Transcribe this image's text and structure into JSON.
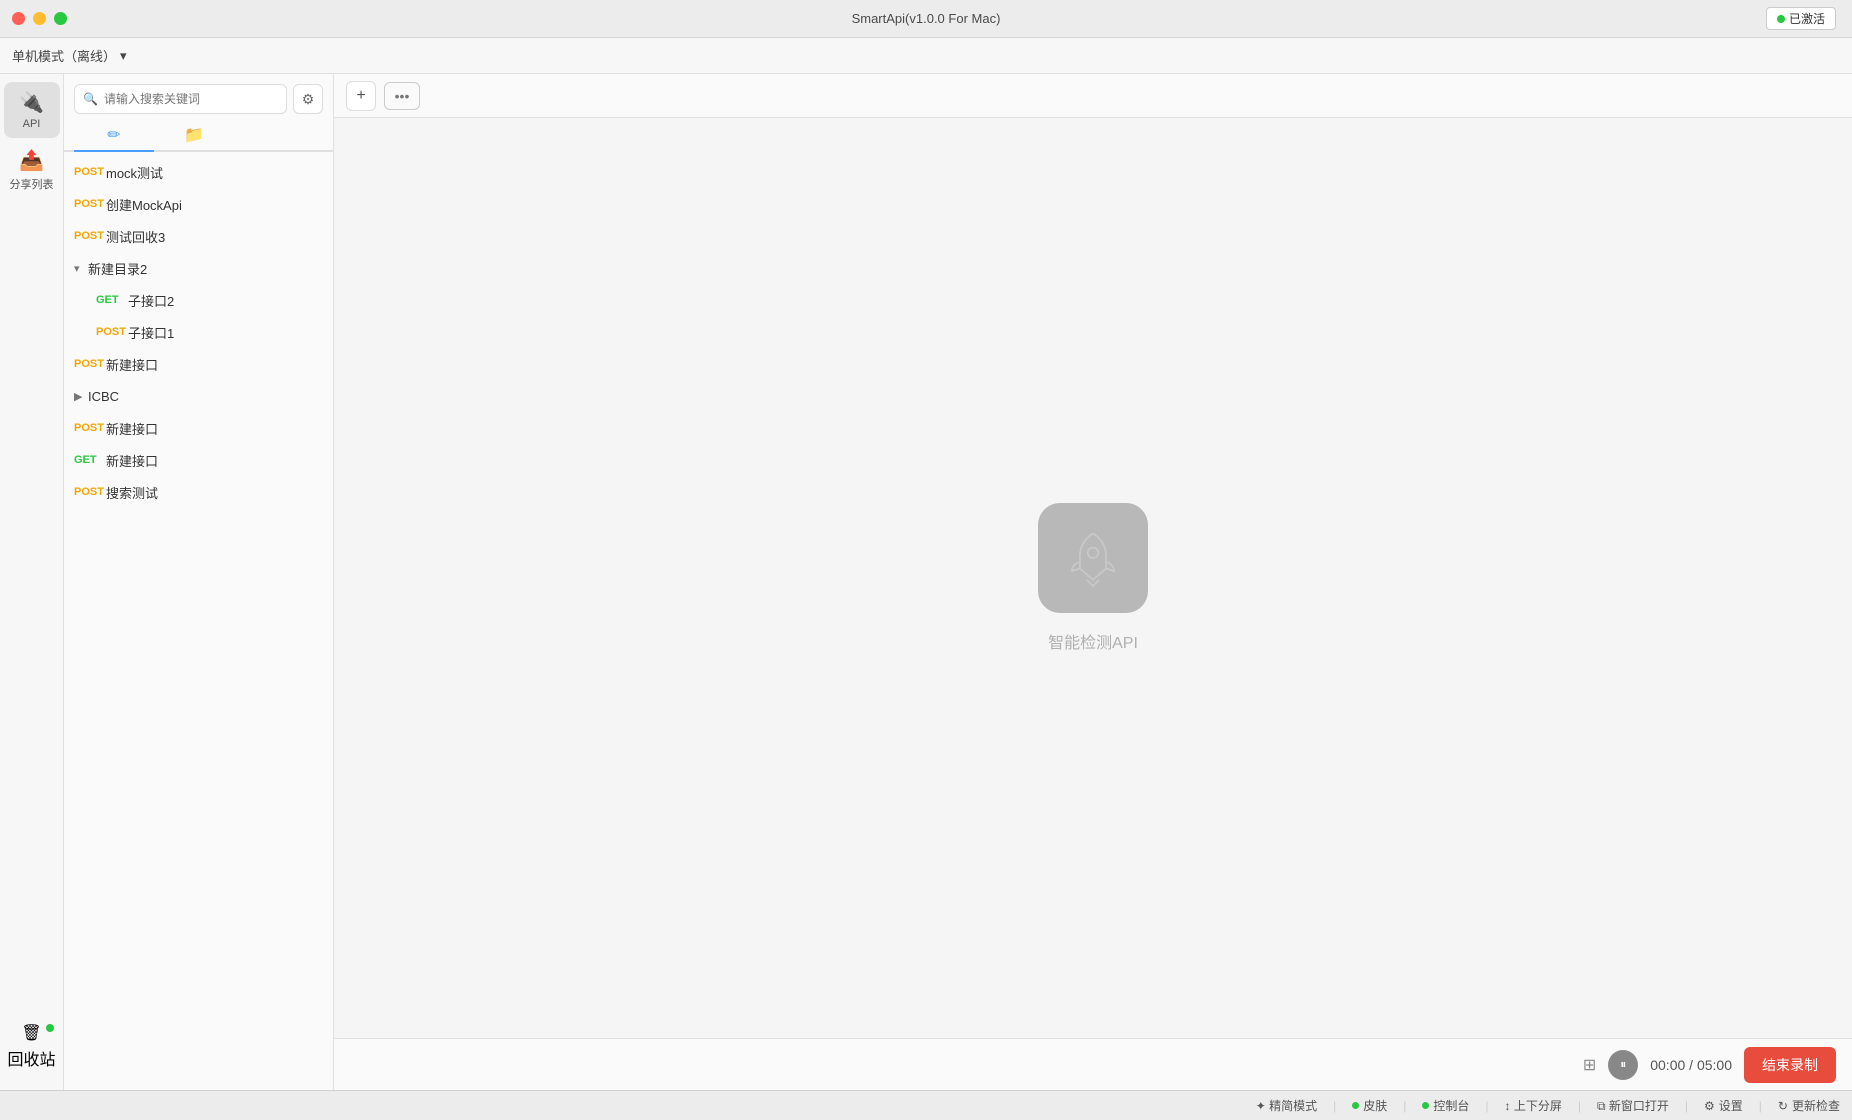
{
  "window": {
    "title": "SmartApi(v1.0.0 For Mac)",
    "activated_label": "已激活"
  },
  "top_bar": {
    "mode_label": "单机模式（离线）",
    "chevron": "▾"
  },
  "search": {
    "placeholder": "请输入搜索关键词"
  },
  "icons": {
    "search": "🔍",
    "settings": "⚙",
    "pen_tab": "✏",
    "folder_tab": "📁",
    "add": "+",
    "more": "•••",
    "api": "API",
    "share": "分享列表",
    "recycle": "回收站",
    "trash_icon": "🗑",
    "share_icon": "⇧"
  },
  "api_list": {
    "items": [
      {
        "method": "POST",
        "name": "mock测试",
        "indent": false
      },
      {
        "method": "POST",
        "name": "创建MockApi",
        "indent": false
      },
      {
        "method": "POST",
        "name": "测试回收3",
        "indent": false
      },
      {
        "type": "folder",
        "name": "新建目录2",
        "expanded": true
      },
      {
        "method": "GET",
        "name": "子接口2",
        "indent": true
      },
      {
        "method": "POST",
        "name": "子接口1",
        "indent": true
      },
      {
        "method": "POST",
        "name": "新建接口",
        "indent": false
      },
      {
        "type": "folder",
        "name": "ICBC",
        "expanded": false
      },
      {
        "method": "POST",
        "name": "新建接口",
        "indent": false
      },
      {
        "method": "GET",
        "name": "新建接口",
        "indent": false
      },
      {
        "method": "POST",
        "name": "搜索测试",
        "indent": false
      }
    ]
  },
  "main": {
    "rocket_hint": "智能检测API",
    "add_btn": "+",
    "more_btn": "•••"
  },
  "recording": {
    "time_current": "00:00",
    "time_total": "05:00",
    "separator": "/",
    "end_label": "结束录制"
  },
  "status_bar": {
    "items": [
      {
        "label": "精简模式",
        "has_dot": false
      },
      {
        "label": "皮肤",
        "has_dot": true
      },
      {
        "label": "控制台",
        "has_dot": true
      },
      {
        "label": "上下分屏",
        "has_dot": false
      },
      {
        "label": "新窗口打开",
        "has_dot": false
      },
      {
        "label": "设置",
        "has_dot": false
      },
      {
        "label": "更新检查",
        "has_dot": false
      }
    ]
  }
}
